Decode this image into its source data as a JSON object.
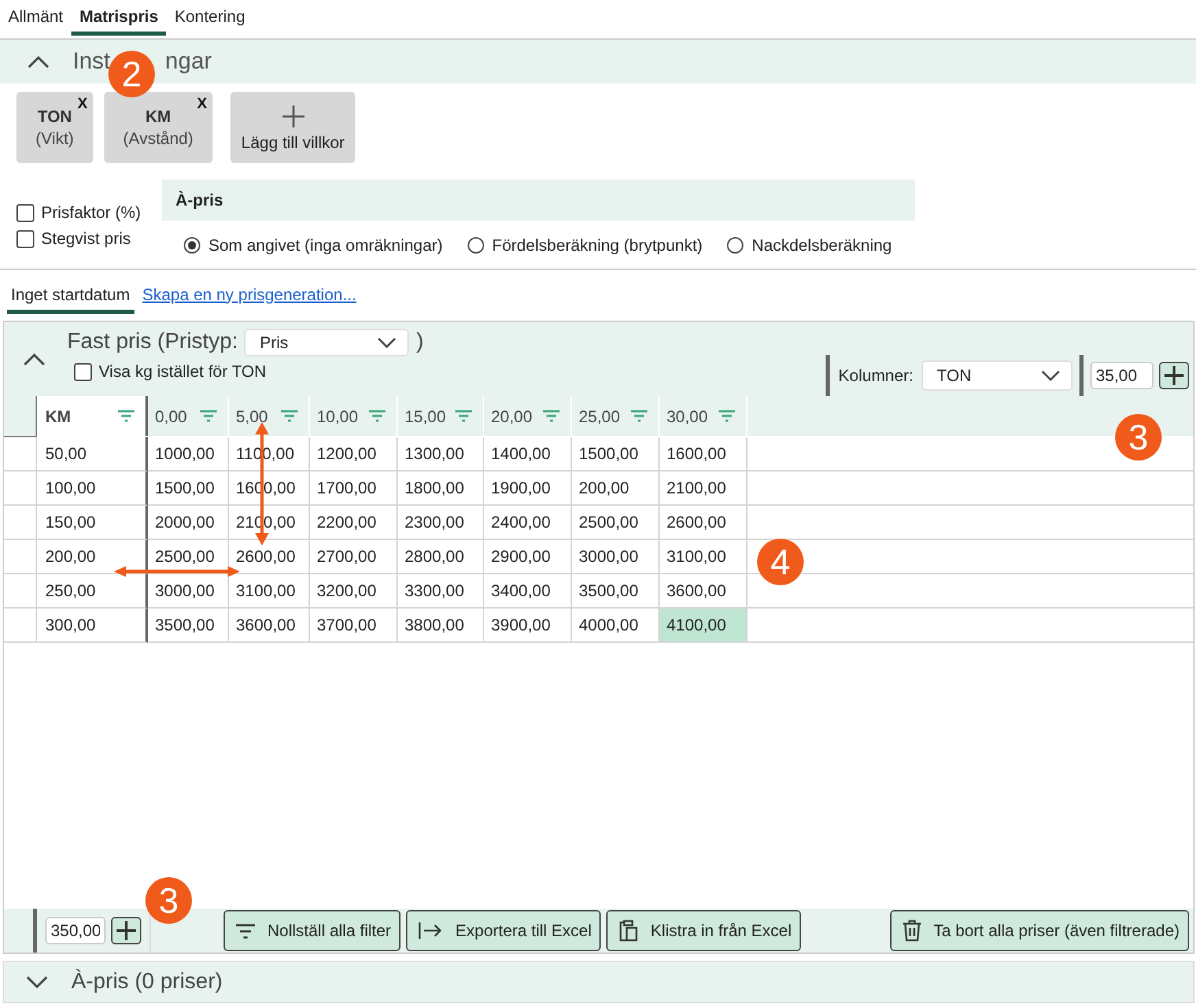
{
  "tabs": [
    {
      "label": "Allmänt",
      "selected": false
    },
    {
      "label": "Matrispris",
      "selected": true
    },
    {
      "label": "Kontering",
      "selected": false
    }
  ],
  "settings": {
    "title_parts": [
      "Inst",
      "ngar"
    ],
    "expanded": true,
    "conditions": [
      {
        "name": "TON",
        "unit": "(Vikt)",
        "remove": "X"
      },
      {
        "name": "KM",
        "unit": "(Avstånd)",
        "remove": "X"
      }
    ],
    "add_condition": "Lägg till villkor",
    "checkboxes": [
      {
        "label": "Prisfaktor (%)",
        "checked": false
      },
      {
        "label": "Stegvist pris",
        "checked": false
      }
    ],
    "a_pris": {
      "title": "À-pris",
      "options": [
        {
          "label": "Som angivet (inga omräkningar)",
          "selected": true
        },
        {
          "label": "Fördelsberäkning (brytpunkt)",
          "selected": false
        },
        {
          "label": "Nackdelsberäkning",
          "selected": false
        }
      ]
    }
  },
  "generations": [
    {
      "label": "Inget startdatum",
      "kind": "tab",
      "selected": true
    },
    {
      "label": "Skapa en ny prisgeneration...",
      "kind": "link",
      "selected": false
    }
  ],
  "grid": {
    "expanded": true,
    "title": "Fast pris (Pristyp:",
    "pristyp": "Pris",
    "title_end": ")",
    "checkbox": {
      "label": "Visa kg istället för TON",
      "checked": false
    },
    "columns_label": "Kolumner:",
    "columns_value": "TON",
    "new_column_value": "35,00",
    "row_header": "KM",
    "columns": [
      "0,00",
      "5,00",
      "10,00",
      "15,00",
      "20,00",
      "25,00",
      "30,00"
    ],
    "rows": [
      {
        "key": "50,00",
        "cells": [
          {
            "value": "1000,00",
            "selected": false
          },
          {
            "value": "1100,00",
            "selected": false
          },
          {
            "value": "1200,00",
            "selected": false
          },
          {
            "value": "1300,00",
            "selected": false
          },
          {
            "value": "1400,00",
            "selected": false
          },
          {
            "value": "1500,00",
            "selected": false
          },
          {
            "value": "1600,00",
            "selected": false
          }
        ]
      },
      {
        "key": "100,00",
        "cells": [
          {
            "value": "1500,00",
            "selected": false
          },
          {
            "value": "1600,00",
            "selected": false
          },
          {
            "value": "1700,00",
            "selected": false
          },
          {
            "value": "1800,00",
            "selected": false
          },
          {
            "value": "1900,00",
            "selected": false
          },
          {
            "value": "200,00",
            "selected": false
          },
          {
            "value": "2100,00",
            "selected": false
          }
        ]
      },
      {
        "key": "150,00",
        "cells": [
          {
            "value": "2000,00",
            "selected": false
          },
          {
            "value": "2100,00",
            "selected": false
          },
          {
            "value": "2200,00",
            "selected": false
          },
          {
            "value": "2300,00",
            "selected": false
          },
          {
            "value": "2400,00",
            "selected": false
          },
          {
            "value": "2500,00",
            "selected": false
          },
          {
            "value": "2600,00",
            "selected": false
          }
        ]
      },
      {
        "key": "200,00",
        "cells": [
          {
            "value": "2500,00",
            "selected": false
          },
          {
            "value": "2600,00",
            "selected": false
          },
          {
            "value": "2700,00",
            "selected": false
          },
          {
            "value": "2800,00",
            "selected": false
          },
          {
            "value": "2900,00",
            "selected": false
          },
          {
            "value": "3000,00",
            "selected": false
          },
          {
            "value": "3100,00",
            "selected": false
          }
        ]
      },
      {
        "key": "250,00",
        "cells": [
          {
            "value": "3000,00",
            "selected": false
          },
          {
            "value": "3100,00",
            "selected": false
          },
          {
            "value": "3200,00",
            "selected": false
          },
          {
            "value": "3300,00",
            "selected": false
          },
          {
            "value": "3400,00",
            "selected": false
          },
          {
            "value": "3500,00",
            "selected": false
          },
          {
            "value": "3600,00",
            "selected": false
          }
        ]
      },
      {
        "key": "300,00",
        "cells": [
          {
            "value": "3500,00",
            "selected": false
          },
          {
            "value": "3600,00",
            "selected": false
          },
          {
            "value": "3700,00",
            "selected": false
          },
          {
            "value": "3800,00",
            "selected": false
          },
          {
            "value": "3900,00",
            "selected": false
          },
          {
            "value": "4000,00",
            "selected": false
          },
          {
            "value": "4100,00",
            "selected": true
          }
        ]
      }
    ],
    "new_row_value": "350,00",
    "buttons": [
      {
        "label": "Nollställ alla filter",
        "kind": "filter"
      },
      {
        "label": "Exportera till Excel",
        "kind": "export"
      },
      {
        "label": "Klistra in från Excel",
        "kind": "paste"
      },
      {
        "label": "Ta bort alla priser (även filtrerade)",
        "kind": "delete"
      }
    ]
  },
  "bottom_section": {
    "title": "À-pris (0 priser)",
    "expanded": false
  },
  "annotations": [
    {
      "label": "2"
    },
    {
      "label": "3"
    },
    {
      "label": "4"
    },
    {
      "label": "3"
    }
  ]
}
